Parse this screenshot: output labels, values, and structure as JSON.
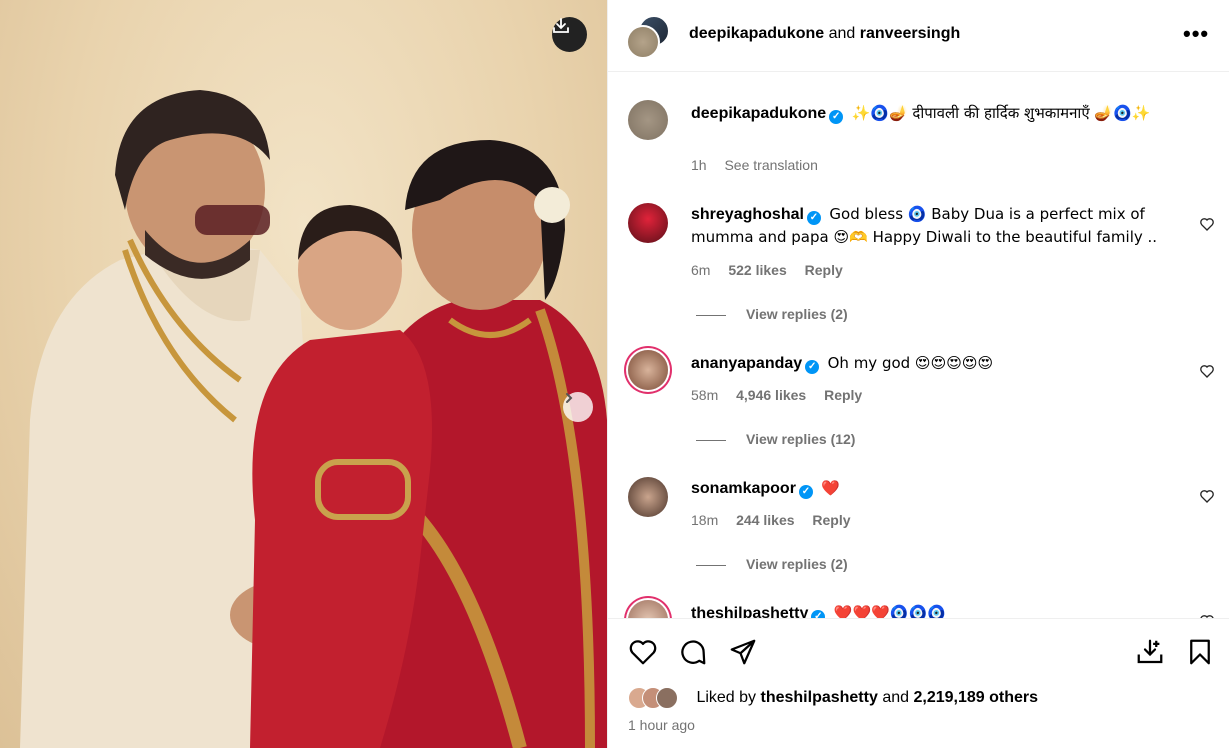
{
  "header": {
    "author": "deepikapadukone",
    "connector": "and",
    "coauthor": "ranveersingh",
    "more_label": "•••"
  },
  "caption": {
    "username": "deepikapadukone",
    "text": "✨🧿🪔 दीपावली की हार्दिक शुभकामनाएँ 🪔🧿✨",
    "time": "1h",
    "see_translation": "See translation"
  },
  "comments": [
    {
      "username": "shreyaghoshal",
      "text": "God bless 🧿 Baby Dua is a perfect mix of mumma and papa 😍🫶 Happy Diwali to the beautiful family ..",
      "time": "6m",
      "likes": "522 likes",
      "reply": "Reply",
      "view_replies": "View replies (2)"
    },
    {
      "username": "ananyapanday",
      "text": "Oh my god 😍😍😍😍😍",
      "time": "58m",
      "likes": "4,946 likes",
      "reply": "Reply",
      "view_replies": "View replies (12)"
    },
    {
      "username": "sonamkapoor",
      "text": "❤️",
      "time": "18m",
      "likes": "244 likes",
      "reply": "Reply",
      "view_replies": "View replies (2)"
    },
    {
      "username": "theshilpashetty",
      "text": "❤️❤️❤️🧿🧿🧿"
    }
  ],
  "likes_line": {
    "prefix": "Liked by",
    "user": "theshilpashetty",
    "middle": "and",
    "others": "2,219,189 others"
  },
  "posted": "1 hour ago",
  "icons": {
    "download": "download-icon",
    "next": "chevron-right-icon",
    "like": "heart-icon",
    "comment": "comment-icon",
    "share": "send-icon",
    "save_download": "save-download-icon",
    "bookmark": "bookmark-icon"
  },
  "colors": {
    "verified": "#0095f6",
    "secondary_text": "#737373",
    "border": "#efefef"
  }
}
